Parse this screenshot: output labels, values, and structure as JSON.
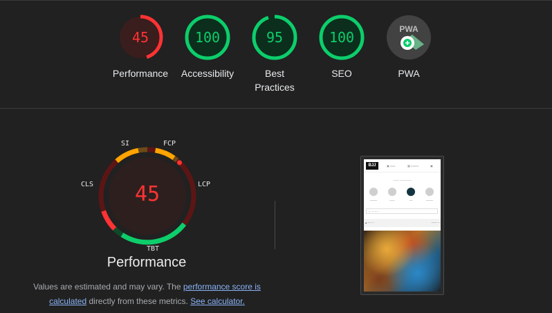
{
  "scores": [
    {
      "value": "45",
      "label": "Performance",
      "color": "#ff3333",
      "track": "#3a1d1d",
      "fraction": 0.45
    },
    {
      "value": "100",
      "label": "Accessibility",
      "color": "#0cce6b",
      "track": "#0c2e1d",
      "fraction": 1.0
    },
    {
      "value": "95",
      "label": "Best Practices",
      "color": "#0cce6b",
      "track": "#0c2e1d",
      "fraction": 0.95
    },
    {
      "value": "100",
      "label": "SEO",
      "color": "#0cce6b",
      "track": "#0c2e1d",
      "fraction": 1.0
    }
  ],
  "pwa": {
    "badge": "PWA",
    "label": "PWA"
  },
  "performance": {
    "score": "45",
    "title": "Performance",
    "metrics": {
      "si": "SI",
      "fcp": "FCP",
      "lcp": "LCP",
      "tbt": "TBT",
      "cls": "CLS"
    }
  },
  "note": {
    "text1": "Values are estimated and may vary. The ",
    "link1": "performance score is calculated",
    "text2": " directly from these metrics. ",
    "link2": "See calculator."
  },
  "colors": {
    "fail": "#ff3333",
    "average": "#ffa400",
    "pass": "#0cce6b",
    "background": "#212121"
  }
}
